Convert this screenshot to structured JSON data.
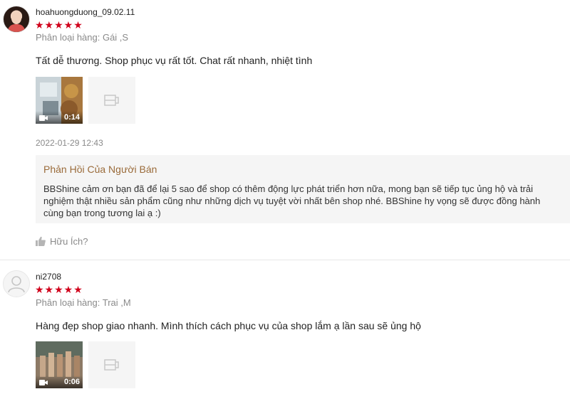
{
  "reviews": [
    {
      "username": "hoahuongduong_09.02.11",
      "stars": "★★★★★",
      "rating": 5,
      "variation": "Phân loại hàng: Gái ,S",
      "content": "Tất dễ thương. Shop phục vụ rất tốt. Chat rất nhanh, nhiệt tình",
      "video_duration": "0:14",
      "timestamp": "2022-01-29 12:43",
      "seller_reply": {
        "title": "Phản Hồi Của Người Bán",
        "body": "BBShine cảm ơn bạn đã để lại 5 sao để shop có thêm động lực phát triển hơn nữa, mong bạn sẽ tiếp tục ủng hộ và trải nghiệm thật nhiều sản phẩm cũng như những dịch vụ tuyệt vời nhất bên shop nhé. BBShine hy vọng sẽ được đồng hành cùng bạn trong tương lai ạ :)"
      },
      "helpful_label": "Hữu Ích?"
    },
    {
      "username": "ni2708",
      "stars": "★★★★★",
      "rating": 5,
      "variation": "Phân loại hàng: Trai ,M",
      "content": "Hàng đẹp shop giao nhanh. Mình thích cách phục vụ của shop lắm ạ lần sau sẽ ủng hộ",
      "video_duration": "0:06"
    }
  ],
  "colors": {
    "star": "#d0011b",
    "reply_title": "#9a6b3a",
    "muted": "#8a8a8a",
    "reply_bg": "#f5f5f5"
  }
}
